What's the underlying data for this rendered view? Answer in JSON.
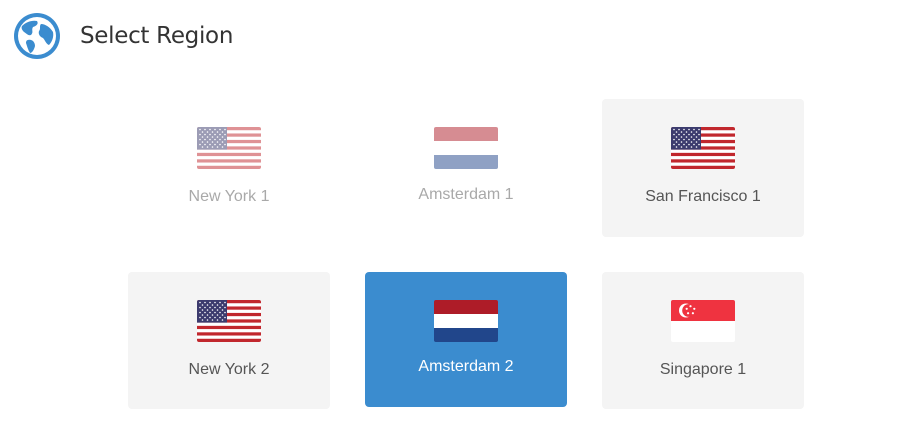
{
  "header": {
    "title": "Select Region",
    "icon": "globe-icon"
  },
  "accent_color": "#3b8ccf",
  "regions": [
    {
      "label": "New York 1",
      "flag": "us-flag-icon",
      "state": "disabled"
    },
    {
      "label": "Amsterdam 1",
      "flag": "nl-flag-icon",
      "state": "disabled"
    },
    {
      "label": "San Francisco 1",
      "flag": "us-flag-icon",
      "state": "available"
    },
    {
      "label": "New York 2",
      "flag": "us-flag-icon",
      "state": "available"
    },
    {
      "label": "Amsterdam 2",
      "flag": "nl-flag-icon",
      "state": "selected"
    },
    {
      "label": "Singapore 1",
      "flag": "sg-flag-icon",
      "state": "available"
    }
  ]
}
